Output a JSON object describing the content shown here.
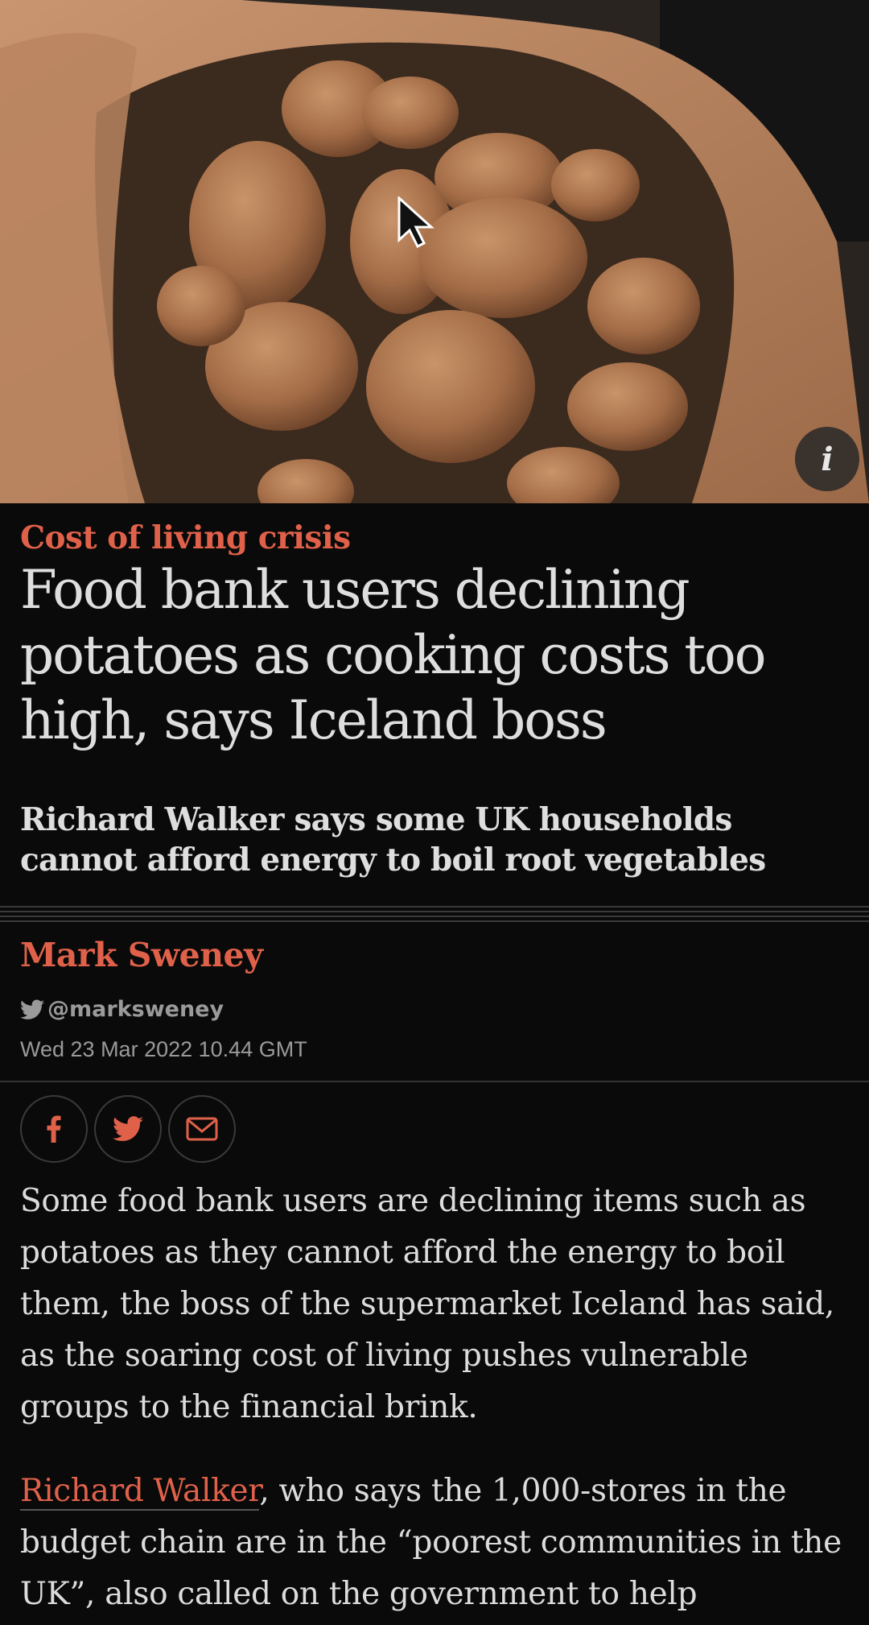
{
  "hero": {
    "image_alt": "",
    "info_label": "i"
  },
  "article": {
    "kicker": "Cost of living crisis",
    "headline": "Food bank users declining potatoes as cooking costs too high, says Iceland boss",
    "standfirst": "Richard Walker says some UK households cannot afford energy to boil root vegetables",
    "author": "Mark Sweney",
    "twitter_handle": "@marksweney",
    "date": "Wed 23 Mar 2022 10.44 GMT"
  },
  "share": {
    "icons": [
      "facebook-icon",
      "twitter-icon",
      "email-icon"
    ]
  },
  "body": {
    "p1": "Some food bank users are declining items such as potatoes as they cannot afford the energy to boil them, the boss of the supermarket Iceland has said, as the soaring cost of living pushes vulnerable groups to the financial brink.",
    "p2_link": "Richard Walker",
    "p2_rest": ", who says the 1,000-stores in the budget chain are in the “poorest communities in the UK”, also called on the government to help"
  },
  "colors": {
    "accent": "#e0614a",
    "background": "#0a0a0a",
    "text": "#dcdcdc"
  }
}
